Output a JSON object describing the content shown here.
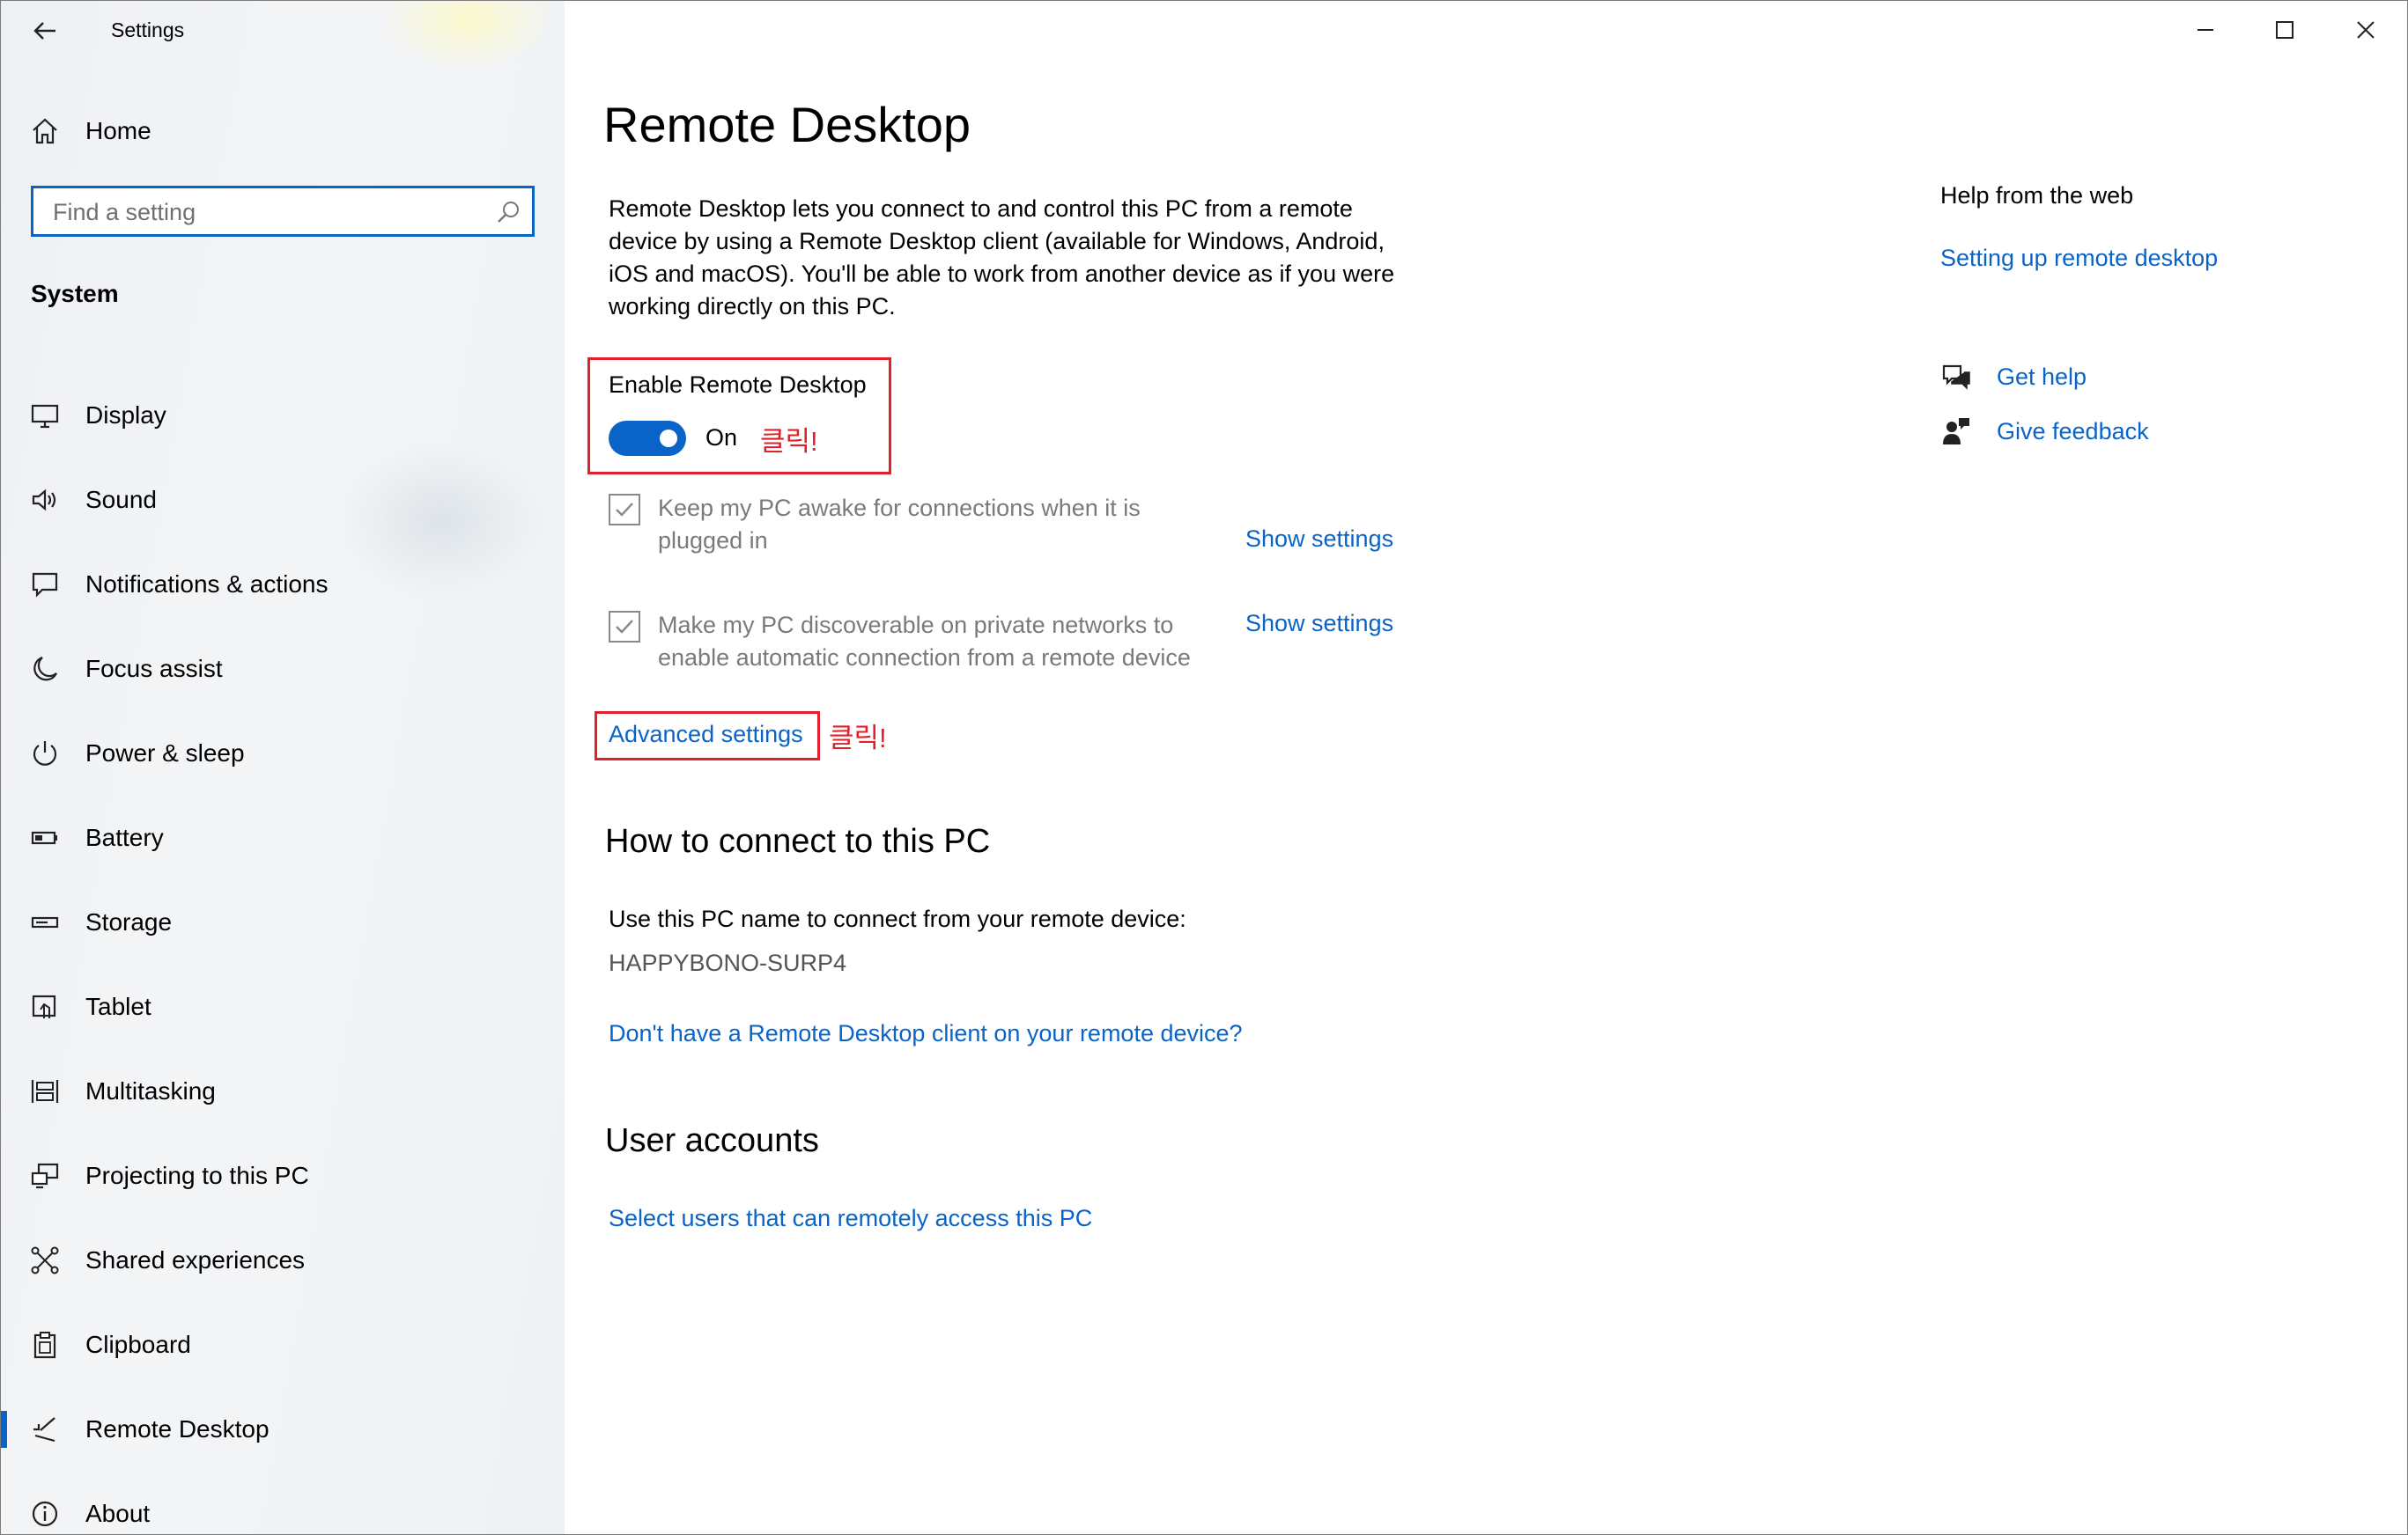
{
  "window": {
    "title": "Settings"
  },
  "sidebar": {
    "home_label": "Home",
    "search_placeholder": "Find a setting",
    "section_label": "System",
    "items": [
      {
        "label": "Display",
        "icon": "monitor-icon"
      },
      {
        "label": "Sound",
        "icon": "speaker-icon"
      },
      {
        "label": "Notifications & actions",
        "icon": "notification-icon"
      },
      {
        "label": "Focus assist",
        "icon": "moon-icon"
      },
      {
        "label": "Power & sleep",
        "icon": "power-icon"
      },
      {
        "label": "Battery",
        "icon": "battery-icon"
      },
      {
        "label": "Storage",
        "icon": "storage-icon"
      },
      {
        "label": "Tablet",
        "icon": "tablet-icon"
      },
      {
        "label": "Multitasking",
        "icon": "multitasking-icon"
      },
      {
        "label": "Projecting to this PC",
        "icon": "projector-icon"
      },
      {
        "label": "Shared experiences",
        "icon": "share-icon"
      },
      {
        "label": "Clipboard",
        "icon": "clipboard-icon"
      },
      {
        "label": "Remote Desktop",
        "icon": "remote-desktop-icon",
        "selected": true
      },
      {
        "label": "About",
        "icon": "info-icon"
      }
    ]
  },
  "main": {
    "title": "Remote Desktop",
    "description": "Remote Desktop lets you connect to and control this PC from a remote device by using a Remote Desktop client (available for Windows, Android, iOS and macOS). You'll be able to work from another device as if you were working directly on this PC.",
    "enable_label": "Enable Remote Desktop",
    "toggle_state": "On",
    "annotation": "클릭!",
    "options": [
      {
        "text": "Keep my PC awake for connections when it is plugged in",
        "link": "Show settings",
        "checked": true
      },
      {
        "text": "Make my PC discoverable on private networks to enable automatic connection from a remote device",
        "link": "Show settings",
        "checked": true
      }
    ],
    "advanced_settings": "Advanced settings",
    "connect_heading": "How to connect to this PC",
    "connect_text": "Use this PC name to connect from your remote device:",
    "pc_name": "HAPPYBONO-SURP4",
    "client_link": "Don't have a Remote Desktop client on your remote device?",
    "accounts_heading": "User accounts",
    "accounts_link": "Select users that can remotely access this PC"
  },
  "help": {
    "heading": "Help from the web",
    "web_link": "Setting up remote desktop",
    "get_help": "Get help",
    "give_feedback": "Give feedback"
  },
  "colors": {
    "accent": "#0a64c8",
    "annotation": "#e0202a"
  }
}
